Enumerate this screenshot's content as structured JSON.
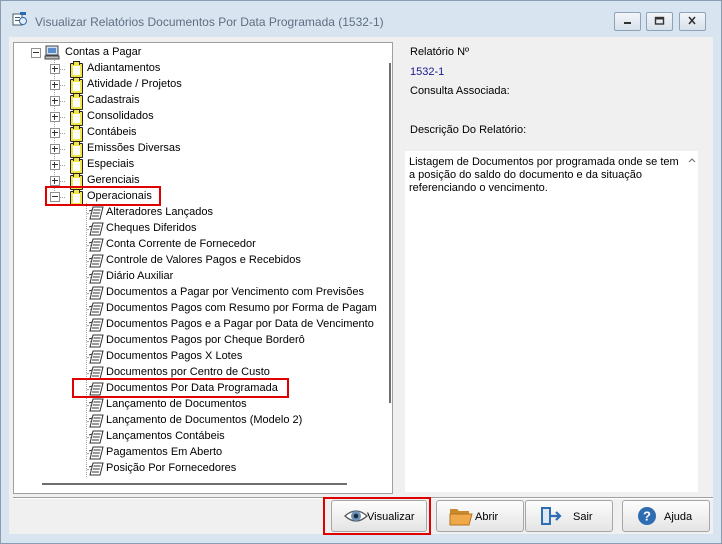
{
  "window": {
    "title": "Visualizar Relatórios Documentos Por Data Programada (1532-1)"
  },
  "tree": {
    "root_label": "Contas a Pagar",
    "folders": [
      "Adiantamentos",
      "Atividade / Projetos",
      "Cadastrais",
      "Consolidados",
      "Contábeis",
      "Emissões Diversas",
      "Especiais",
      "Gerenciais"
    ],
    "expanded_folder": "Operacionais",
    "reports": [
      "Alteradores Lançados",
      "Cheques Diferidos",
      "Conta Corrente de Fornecedor",
      "Controle de Valores Pagos e Recebidos",
      "Diário Auxiliar",
      "Documentos a Pagar por Vencimento com Previsões",
      "Documentos Pagos com Resumo por Forma de Pagam",
      "Documentos Pagos e a Pagar por Data de Vencimento",
      "Documentos Pagos por Cheque Borderô",
      "Documentos Pagos X Lotes",
      "Documentos por Centro de Custo",
      "Documentos Por Data Programada",
      "Lançamento de Documentos",
      "Lançamento de Documentos (Modelo 2)",
      "Lançamentos Contábeis",
      "Pagamentos Em Aberto",
      "Posição Por Fornecedores"
    ],
    "selected_report": "Documentos Por Data Programada"
  },
  "info": {
    "report_number_label": "Relatório Nº",
    "report_number_value": "1532-1",
    "query_label": "Consulta Associada:",
    "description_label": "Descrição Do Relatório:",
    "description_text": "Listagem de Documentos por programada onde se tem a posição do saldo do documento e da situação referenciando o vencimento."
  },
  "buttons": {
    "visualizar": "Visualizar",
    "abrir": "Abrir",
    "sair": "Sair",
    "ajuda": "Ajuda"
  },
  "colors": {
    "highlight": "#e00000",
    "title_bg": "#d9e4f1",
    "folder_yellow": "#f2e64a",
    "value_blue": "#1a1a8c"
  },
  "icons": {
    "title": "report-app-icon",
    "root": "computer-icon",
    "folder": "report-folder-icon",
    "report": "report-document-icon",
    "visualizar": "eye-icon",
    "abrir": "open-folder-icon",
    "sair": "exit-door-icon",
    "ajuda": "help-icon"
  }
}
